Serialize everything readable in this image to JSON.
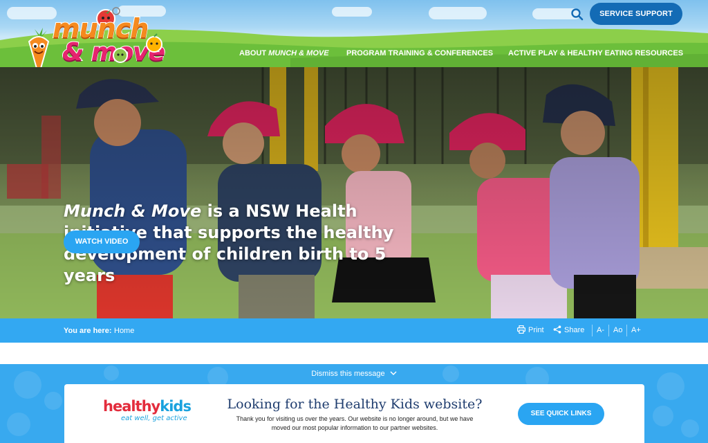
{
  "header": {
    "logo": {
      "line1": "munch",
      "line2": "& move"
    },
    "search_icon": "search-icon",
    "service_support": "SERVICE SUPPORT",
    "nav": {
      "about_prefix": "ABOUT ",
      "about_brand": "MUNCH & MOVE",
      "training": "PROGRAM TRAINING & CONFERENCES",
      "resources": "ACTIVE PLAY & HEALTHY EATING RESOURCES"
    }
  },
  "hero": {
    "brand": "Munch & Move",
    "headline_rest": " is a NSW Health initiative that supports the healthy development of children birth to 5 years",
    "watch_video": "WATCH VIDEO"
  },
  "breadcrumb": {
    "label": "You are here:",
    "current": "Home"
  },
  "tools": {
    "print": "Print",
    "share": "Share",
    "font_smaller": "A-",
    "font_reset": "Ao",
    "font_larger": "A+"
  },
  "notice": {
    "dismiss": "Dismiss this message",
    "logo_text_main": "healthy",
    "logo_text_kids": "kids",
    "logo_tagline": "eat well, get active",
    "title": "Looking for the Healthy Kids website?",
    "body": "Thank you for visiting us over the years. Our website is no longer around, but we have moved our most popular information to our partner websites.",
    "quick_links": "SEE QUICK LINKS"
  },
  "colors": {
    "brand_blue": "#136bb5",
    "accent_blue": "#2aa5f2",
    "bar_blue": "#33a8f2",
    "grass_green": "#6cbf3b",
    "title_navy": "#1e3c6e"
  }
}
